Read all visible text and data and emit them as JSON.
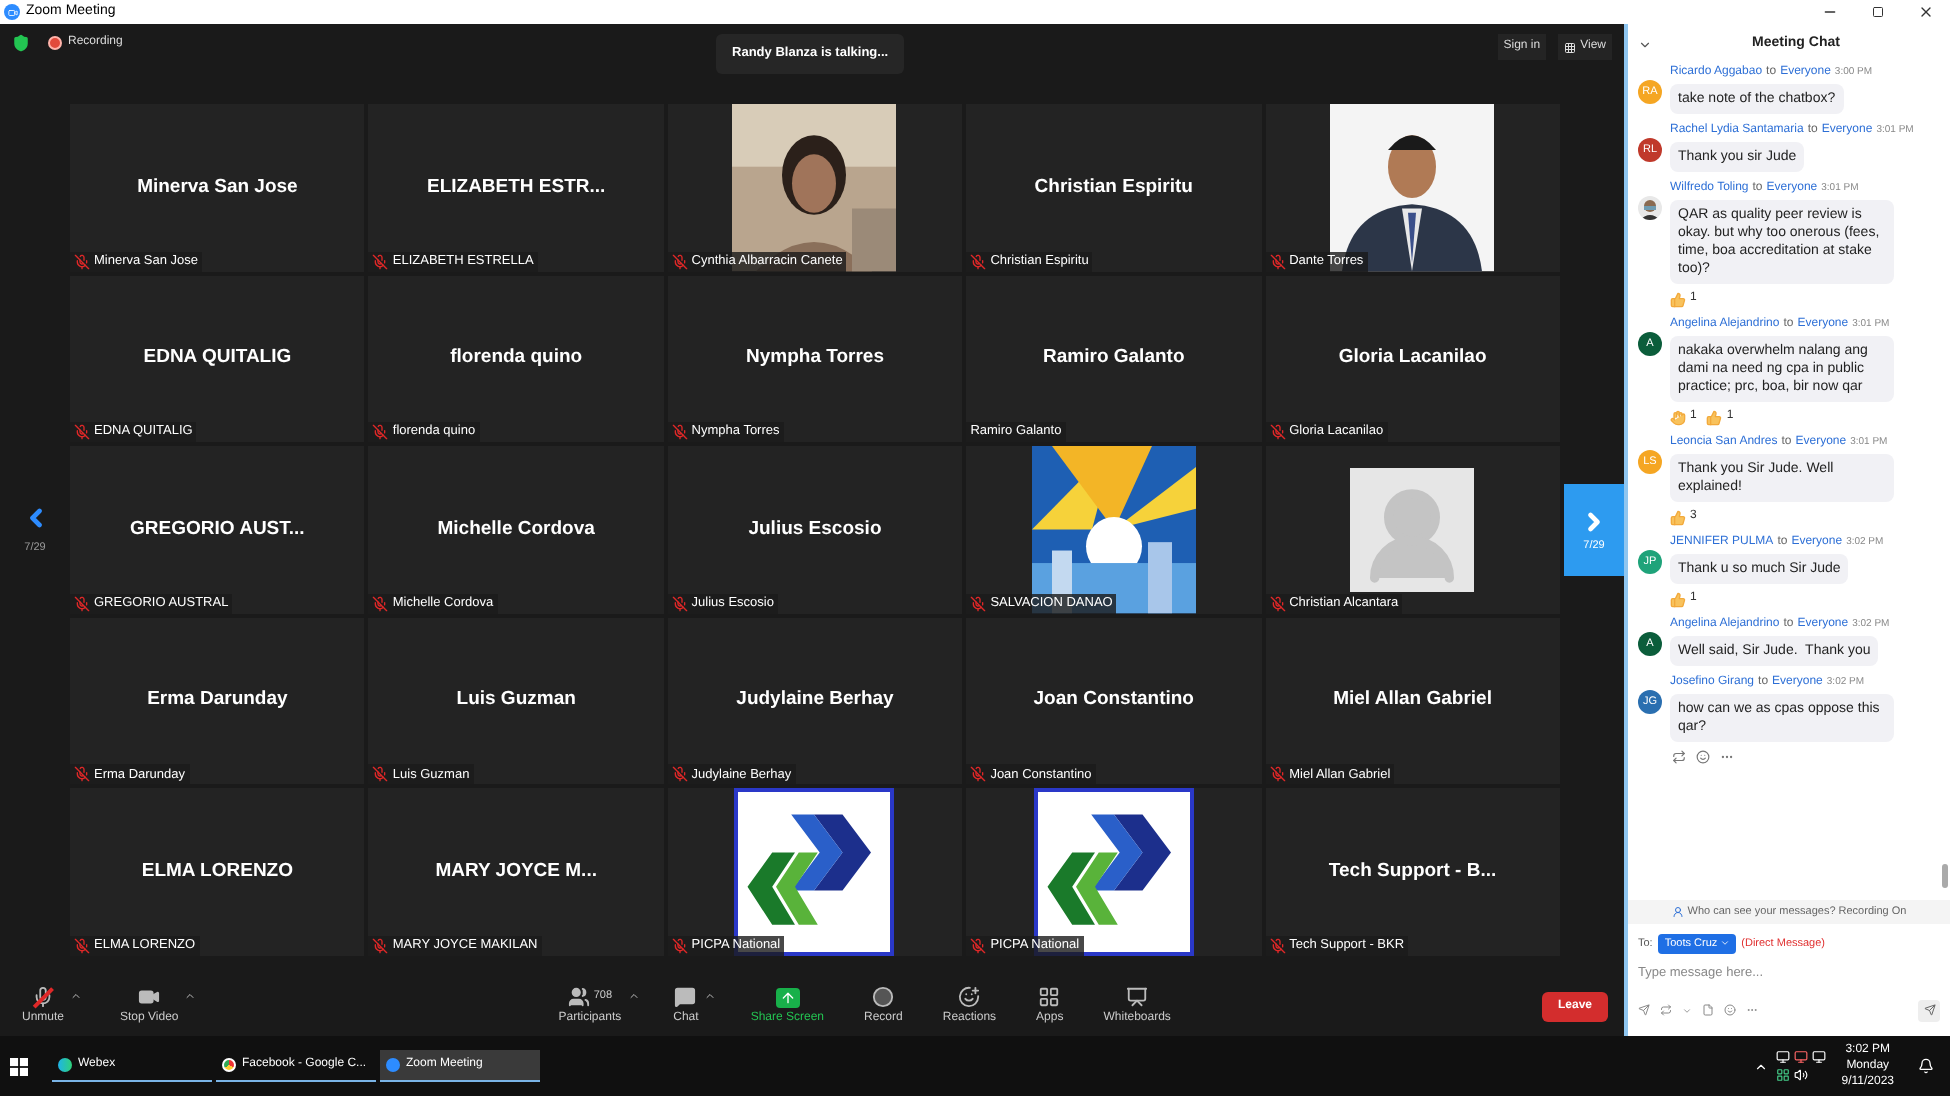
{
  "window": {
    "title": "Zoom Meeting"
  },
  "top_bar": {
    "recording": "Recording",
    "talking": "Randy Blanza is talking...",
    "sign_in": "Sign in",
    "view": "View"
  },
  "pager": {
    "left": "7/29",
    "right": "7/29"
  },
  "tiles": [
    {
      "kind": "name",
      "display": "Minerva San Jose",
      "label": "Minerva San Jose",
      "muted": true
    },
    {
      "kind": "name",
      "display": "ELIZABETH  ESTR...",
      "label": "ELIZABETH ESTRELLA",
      "muted": true
    },
    {
      "label": "Cynthia Albarracin Canete",
      "muted": true
    },
    {
      "kind": "name",
      "display": "Christian Espiritu",
      "label": "Christian Espiritu",
      "muted": true
    },
    {
      "label": "Dante Torres",
      "muted": true
    },
    {
      "kind": "name",
      "display": "EDNA QUITALIG",
      "label": "EDNA QUITALIG",
      "muted": true
    },
    {
      "kind": "name",
      "display": "florenda quino",
      "label": "florenda quino",
      "muted": true
    },
    {
      "kind": "name",
      "display": "Nympha Torres",
      "label": "Nympha Torres",
      "muted": true
    },
    {
      "kind": "name",
      "display": "Ramiro Galanto",
      "label": "Ramiro Galanto",
      "muted": false
    },
    {
      "kind": "name",
      "display": "Gloria Lacanilao",
      "label": "Gloria Lacanilao",
      "muted": true
    },
    {
      "kind": "name",
      "display": "GREGORIO  AUST...",
      "label": "GREGORIO AUSTRAL",
      "muted": true
    },
    {
      "kind": "name",
      "display": "Michelle Cordova",
      "label": "Michelle Cordova",
      "muted": true
    },
    {
      "kind": "name",
      "display": "Julius Escosio",
      "label": "Julius Escosio",
      "muted": true
    },
    {
      "kind": "picture",
      "label": "SALVACION DANAO",
      "muted": true
    },
    {
      "kind": "avatar",
      "label": "Christian Alcantara",
      "muted": true
    },
    {
      "kind": "name",
      "display": "Erma Darunday",
      "label": "Erma Darunday",
      "muted": true
    },
    {
      "kind": "name",
      "display": "Luis Guzman",
      "label": "Luis Guzman",
      "muted": true
    },
    {
      "kind": "name",
      "display": "Judylaine Berhay",
      "label": "Judylaine Berhay",
      "muted": true
    },
    {
      "kind": "name",
      "display": "Joan Constantino",
      "label": "Joan Constantino",
      "muted": true
    },
    {
      "kind": "name",
      "display": "Miel Allan Gabriel",
      "label": "Miel Allan Gabriel",
      "muted": true
    },
    {
      "kind": "name",
      "display": "ELMA LORENZO",
      "label": "ELMA LORENZO",
      "muted": true
    },
    {
      "kind": "name",
      "display": "MARY JOYCE M...",
      "label": "MARY JOYCE MAKILAN",
      "muted": true
    },
    {
      "kind": "logo",
      "label": "PICPA National",
      "muted": true
    },
    {
      "kind": "logo",
      "label": "PICPA National",
      "muted": true
    },
    {
      "kind": "name",
      "display": "Tech Support - B...",
      "label": "Tech Support - BKR",
      "muted": true
    }
  ],
  "toolbar": [
    {
      "kind": "unmute",
      "label": "Unmute"
    },
    {
      "kind": "video",
      "label": "Stop Video"
    },
    {
      "kind": "participants",
      "label": "Participants",
      "count": "708"
    },
    {
      "kind": "chat",
      "label": "Chat"
    },
    {
      "kind": "share",
      "label": "Share Screen"
    },
    {
      "kind": "record",
      "label": "Record"
    },
    {
      "kind": "reactions",
      "label": "Reactions"
    },
    {
      "kind": "apps",
      "label": "Apps"
    },
    {
      "kind": "whiteboards",
      "label": "Whiteboards"
    }
  ],
  "leave": "Leave",
  "chat": {
    "title": "Meeting Chat",
    "messages": [
      {
        "kind": "initials",
        "initials": "RA",
        "color": "#f5a623",
        "sender": "Ricardo Aggabao",
        "to": "to",
        "recipient": "Everyone",
        "time": "3:00 PM",
        "text": "take note of the chatbox?"
      },
      {
        "kind": "initials",
        "initials": "RL",
        "color": "#c0392b",
        "sender": "Rachel Lydia Santamaria",
        "to": "to",
        "recipient": "Everyone",
        "time": "3:01 PM",
        "text": "Thank you sir Jude"
      },
      {
        "kind": "picture",
        "sender": "Wilfredo Toling",
        "to": "to",
        "recipient": "Everyone",
        "time": "3:01 PM",
        "text": "QAR as quality peer review is okay. but why too onerous (fees, time, boa accreditation at stake too)?",
        "reactions": [
          {
            "kind": "thumbs",
            "count": "1"
          }
        ]
      },
      {
        "kind": "initials",
        "initials": "A",
        "color": "#0b5d3b",
        "sender": "Angelina Alejandrino",
        "to": "to",
        "recipient": "Everyone",
        "time": "3:01 PM",
        "text": "nakaka overwhelm nalang ang dami na need ng cpa in public practice; prc, boa, bir now qar",
        "reactions": [
          {
            "kind": "ok",
            "count": "1"
          },
          {
            "kind": "thumbs",
            "count": "1"
          }
        ]
      },
      {
        "kind": "initials",
        "initials": "LS",
        "color": "#f5a623",
        "sender": "Leoncia San Andres",
        "to": "to",
        "recipient": "Everyone",
        "time": "3:01 PM",
        "text": "Thank you Sir Jude. Well explained!",
        "reactions": [
          {
            "kind": "thumbs",
            "count": "3"
          }
        ]
      },
      {
        "kind": "initials",
        "initials": "JP",
        "color": "#1fa37a",
        "sender": "JENNIFER PULMA",
        "to": "to",
        "recipient": "Everyone",
        "time": "3:02 PM",
        "text": "Thank u so much Sir Jude",
        "reactions": [
          {
            "kind": "thumbs",
            "count": "1"
          }
        ]
      },
      {
        "kind": "initials",
        "initials": "A",
        "color": "#0b5d3b",
        "sender": "Angelina Alejandrino",
        "to": "to",
        "recipient": "Everyone",
        "time": "3:02 PM",
        "text": "Well said, Sir Jude.  Thank you"
      },
      {
        "kind": "initials",
        "initials": "JG",
        "color": "#2a6fb0",
        "sender": "Josefino Girang",
        "to": "to",
        "recipient": "Everyone",
        "time": "3:02 PM",
        "text": "how can we as cpas oppose this qar?"
      }
    ],
    "info": "Who can see your messages? Recording On",
    "to_label": "To:",
    "recipient": "Toots Cruz",
    "direct": "(Direct Message)",
    "placeholder": "Type message here..."
  },
  "taskbar": {
    "items": [
      {
        "kind": "webex",
        "label": "Webex",
        "selected": false
      },
      {
        "kind": "chrome",
        "label": "Facebook - Google C...",
        "selected": false
      },
      {
        "kind": "zoom",
        "label": "Zoom Meeting",
        "selected": true
      }
    ],
    "time": "3:02 PM",
    "day": "Monday",
    "date": "9/11/2023"
  }
}
